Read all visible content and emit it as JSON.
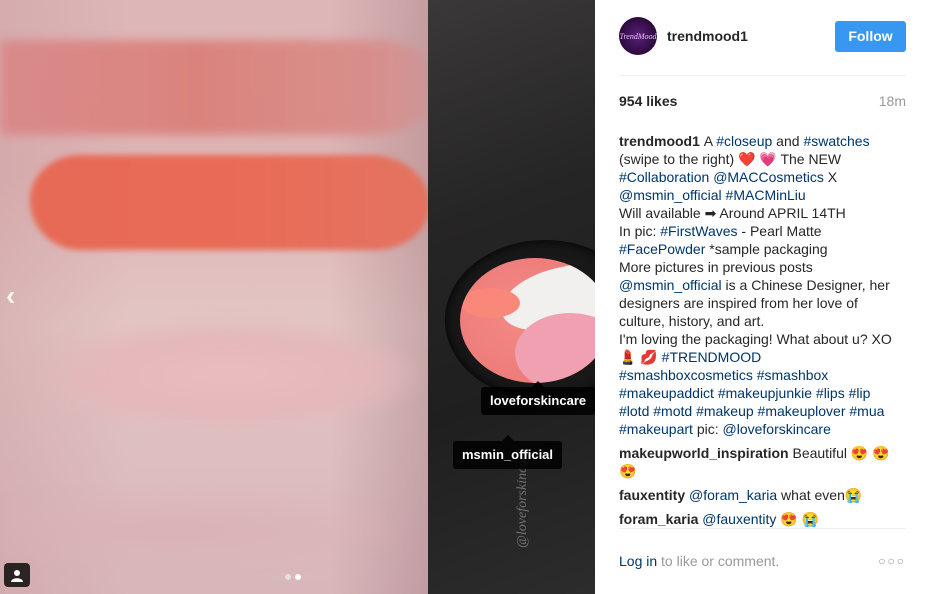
{
  "photo": {
    "tags": [
      "loveforskincare",
      "msmin_official"
    ],
    "watermark": "@loveforskincare",
    "carousel": {
      "total": 2,
      "active": 2
    }
  },
  "header": {
    "avatar_text": "TrendMood",
    "username": "trendmood1",
    "follow_label": "Follow"
  },
  "meta": {
    "likes": "954 likes",
    "time": "18m"
  },
  "caption": {
    "author": "trendmood1",
    "lines": [
      [
        {
          "t": "text",
          "v": "A "
        },
        {
          "t": "hashtag",
          "v": "#closeup"
        },
        {
          "t": "text",
          "v": " and "
        },
        {
          "t": "hashtag",
          "v": "#swatches"
        }
      ],
      [
        {
          "t": "text",
          "v": "(swipe to the right) ❤️ 💗 The NEW"
        }
      ],
      [
        {
          "t": "hashtag",
          "v": "#Collaboration"
        },
        {
          "t": "text",
          "v": " "
        },
        {
          "t": "mention",
          "v": "@MACCosmetics"
        },
        {
          "t": "text",
          "v": " X"
        }
      ],
      [
        {
          "t": "mention",
          "v": "@msmin_official"
        },
        {
          "t": "text",
          "v": " "
        },
        {
          "t": "hashtag",
          "v": "#MACMinLiu"
        }
      ],
      [
        {
          "t": "text",
          "v": "Will available ➡ Around APRIL 14TH"
        }
      ],
      [
        {
          "t": "text",
          "v": "In pic: "
        },
        {
          "t": "hashtag",
          "v": "#FirstWaves"
        },
        {
          "t": "text",
          "v": " - Pearl Matte"
        }
      ],
      [
        {
          "t": "hashtag",
          "v": "#FacePowder"
        },
        {
          "t": "text",
          "v": " *sample packaging"
        }
      ],
      [
        {
          "t": "text",
          "v": "More pictures in previous posts"
        }
      ],
      [
        {
          "t": "mention",
          "v": "@msmin_official"
        },
        {
          "t": "text",
          "v": " is a Chinese Designer, her"
        }
      ],
      [
        {
          "t": "text",
          "v": "designers are inspired from her love of"
        }
      ],
      [
        {
          "t": "text",
          "v": "culture, history, and art."
        }
      ],
      [
        {
          "t": "text",
          "v": "I'm loving the packaging! What about u? XO"
        }
      ],
      [
        {
          "t": "text",
          "v": "💄 💋 "
        },
        {
          "t": "hashtag",
          "v": "#TRENDMOOD"
        }
      ],
      [
        {
          "t": "hashtag",
          "v": "#smashboxcosmetics"
        },
        {
          "t": "text",
          "v": " "
        },
        {
          "t": "hashtag",
          "v": "#smashbox"
        }
      ],
      [
        {
          "t": "hashtag",
          "v": "#makeupaddict"
        },
        {
          "t": "text",
          "v": " "
        },
        {
          "t": "hashtag",
          "v": "#makeupjunkie"
        },
        {
          "t": "text",
          "v": " "
        },
        {
          "t": "hashtag",
          "v": "#lips"
        },
        {
          "t": "text",
          "v": " "
        },
        {
          "t": "hashtag",
          "v": "#lip"
        }
      ],
      [
        {
          "t": "hashtag",
          "v": "#lotd"
        },
        {
          "t": "text",
          "v": " "
        },
        {
          "t": "hashtag",
          "v": "#motd"
        },
        {
          "t": "text",
          "v": " "
        },
        {
          "t": "hashtag",
          "v": "#makeup"
        },
        {
          "t": "text",
          "v": " "
        },
        {
          "t": "hashtag",
          "v": "#makeuplover"
        },
        {
          "t": "text",
          "v": " "
        },
        {
          "t": "hashtag",
          "v": "#mua"
        }
      ],
      [
        {
          "t": "hashtag",
          "v": "#makeupart"
        },
        {
          "t": "text",
          "v": " pic: "
        },
        {
          "t": "mention",
          "v": "@loveforskincare"
        }
      ]
    ]
  },
  "comments": [
    {
      "author": "makeupworld_inspiration",
      "parts": [
        {
          "t": "text",
          "v": " Beautiful 😍 😍 😍"
        }
      ]
    },
    {
      "author": "fauxentity",
      "parts": [
        {
          "t": "text",
          "v": " "
        },
        {
          "t": "mention",
          "v": "@foram_karia"
        },
        {
          "t": "text",
          "v": " what even😭"
        }
      ]
    },
    {
      "author": "foram_karia",
      "parts": [
        {
          "t": "text",
          "v": " "
        },
        {
          "t": "mention",
          "v": "@fauxentity"
        },
        {
          "t": "text",
          "v": " 😍 😭"
        }
      ]
    }
  ],
  "footer": {
    "login_label": "Log in",
    "prompt": " to like or comment.",
    "more_label": "○○○"
  },
  "colors": {
    "accent": "#3897f0",
    "link": "#003569",
    "muted": "#999999"
  }
}
